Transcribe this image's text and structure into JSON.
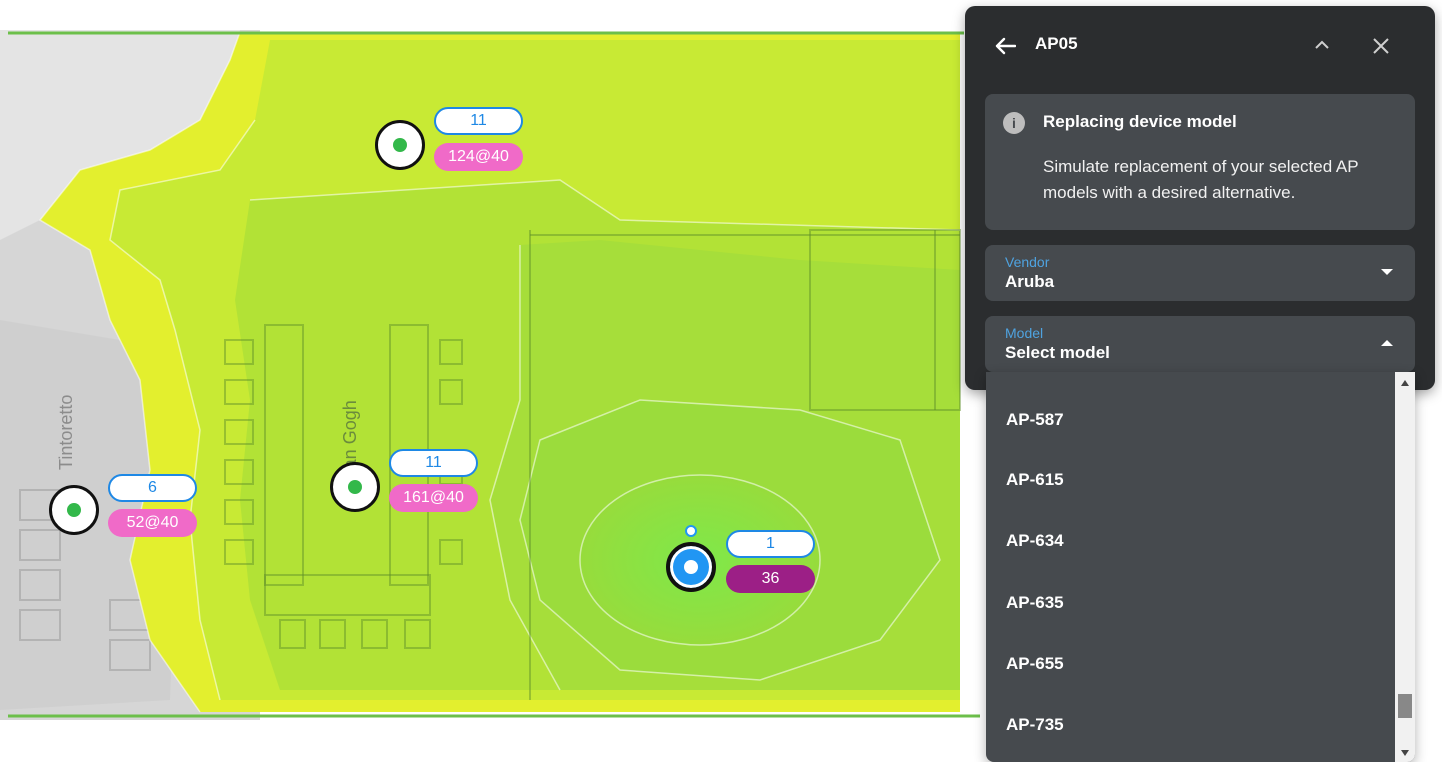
{
  "panel": {
    "title": "AP05",
    "info": {
      "title": "Replacing device model",
      "body": "Simulate replacement of your selected AP models with a desired alternative."
    },
    "vendor": {
      "label": "Vendor",
      "value": "Aruba"
    },
    "model": {
      "label": "Model",
      "value": "Select model"
    },
    "options": [
      "AP-587",
      "AP-615",
      "AP-634",
      "AP-635",
      "AP-655",
      "AP-735"
    ]
  },
  "map": {
    "rooms": [
      "Tintoretto",
      "Van Gogh"
    ],
    "access_points": [
      {
        "channel": "11",
        "clients": "124@40",
        "selected": false
      },
      {
        "channel": "6",
        "clients": "52@40",
        "selected": false
      },
      {
        "channel": "11",
        "clients": "161@40",
        "selected": false
      },
      {
        "channel": "1",
        "clients": "36",
        "selected": true
      }
    ]
  },
  "colors": {
    "panel_bg": "#2b2d2f",
    "card_bg": "#464a4e",
    "accent_blue": "#4fa3e0",
    "client_pill": "#f06ac8",
    "client_pill_selected": "#9c1f86",
    "ap_dot": "#33b84a",
    "selected_ap": "#2196f3"
  },
  "icons": [
    "back-arrow-icon",
    "chevron-up-icon",
    "close-icon",
    "info-icon",
    "caret-down-icon",
    "caret-up-icon"
  ]
}
